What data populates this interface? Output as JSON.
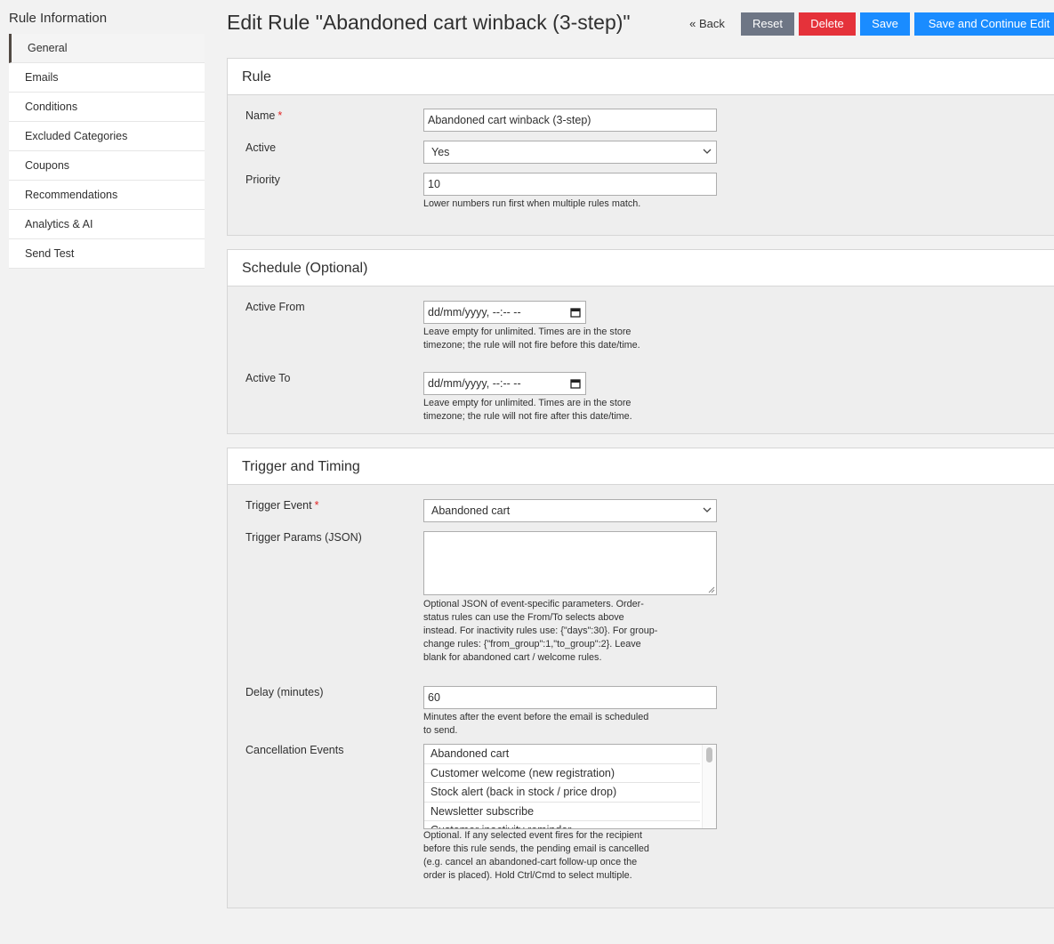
{
  "sidebar": {
    "title": "Rule Information",
    "items": [
      {
        "label": "General"
      },
      {
        "label": "Emails"
      },
      {
        "label": "Conditions"
      },
      {
        "label": "Excluded Categories"
      },
      {
        "label": "Coupons"
      },
      {
        "label": "Recommendations"
      },
      {
        "label": "Analytics & AI"
      },
      {
        "label": "Send Test"
      }
    ]
  },
  "header": {
    "title": "Edit Rule \"Abandoned cart winback (3-step)\"",
    "back_label": "« Back",
    "reset_label": "Reset",
    "delete_label": "Delete",
    "save_label": "Save",
    "save_continue_label": "Save and Continue Edit"
  },
  "rule_panel": {
    "title": "Rule",
    "name_label": "Name",
    "name_value": "Abandoned cart winback (3-step)",
    "active_label": "Active",
    "active_value": "Yes",
    "priority_label": "Priority",
    "priority_value": "10",
    "priority_note": "Lower numbers run first when multiple rules match."
  },
  "schedule_panel": {
    "title": "Schedule (Optional)",
    "from_label": "Active From",
    "from_value": "dd/mm/yyyy, --:-- --",
    "from_note": "Leave empty for unlimited. Times are in the store timezone; the rule will not fire before this date/time.",
    "to_label": "Active To",
    "to_value": "dd/mm/yyyy, --:-- --",
    "to_note": "Leave empty for unlimited. Times are in the store timezone; the rule will not fire after this date/time."
  },
  "trigger_panel": {
    "title": "Trigger and Timing",
    "event_label": "Trigger Event",
    "event_value": "Abandoned cart",
    "params_label": "Trigger Params (JSON)",
    "params_value": "",
    "params_note": "Optional JSON of event-specific parameters. Order-status rules can use the From/To selects above instead. For inactivity rules use: {\"days\":30}. For group-change rules: {\"from_group\":1,\"to_group\":2}. Leave blank for abandoned cart / welcome rules.",
    "delay_label": "Delay (minutes)",
    "delay_value": "60",
    "delay_note": "Minutes after the event before the email is scheduled to send.",
    "cancel_label": "Cancellation Events",
    "cancel_options": [
      "Abandoned cart",
      "Customer welcome (new registration)",
      "Stock alert (back in stock / price drop)",
      "Newsletter subscribe",
      "Customer inactivity reminder"
    ],
    "cancel_note": "Optional. If any selected event fires for the recipient before this rule sends, the pending email is cancelled (e.g. cancel an abandoned-cart follow-up once the order is placed). Hold Ctrl/Cmd to select multiple."
  },
  "colors": {
    "reset": "#6e7685",
    "delete": "#e5323a",
    "save": "#1a8cff",
    "required": "#e22626"
  }
}
